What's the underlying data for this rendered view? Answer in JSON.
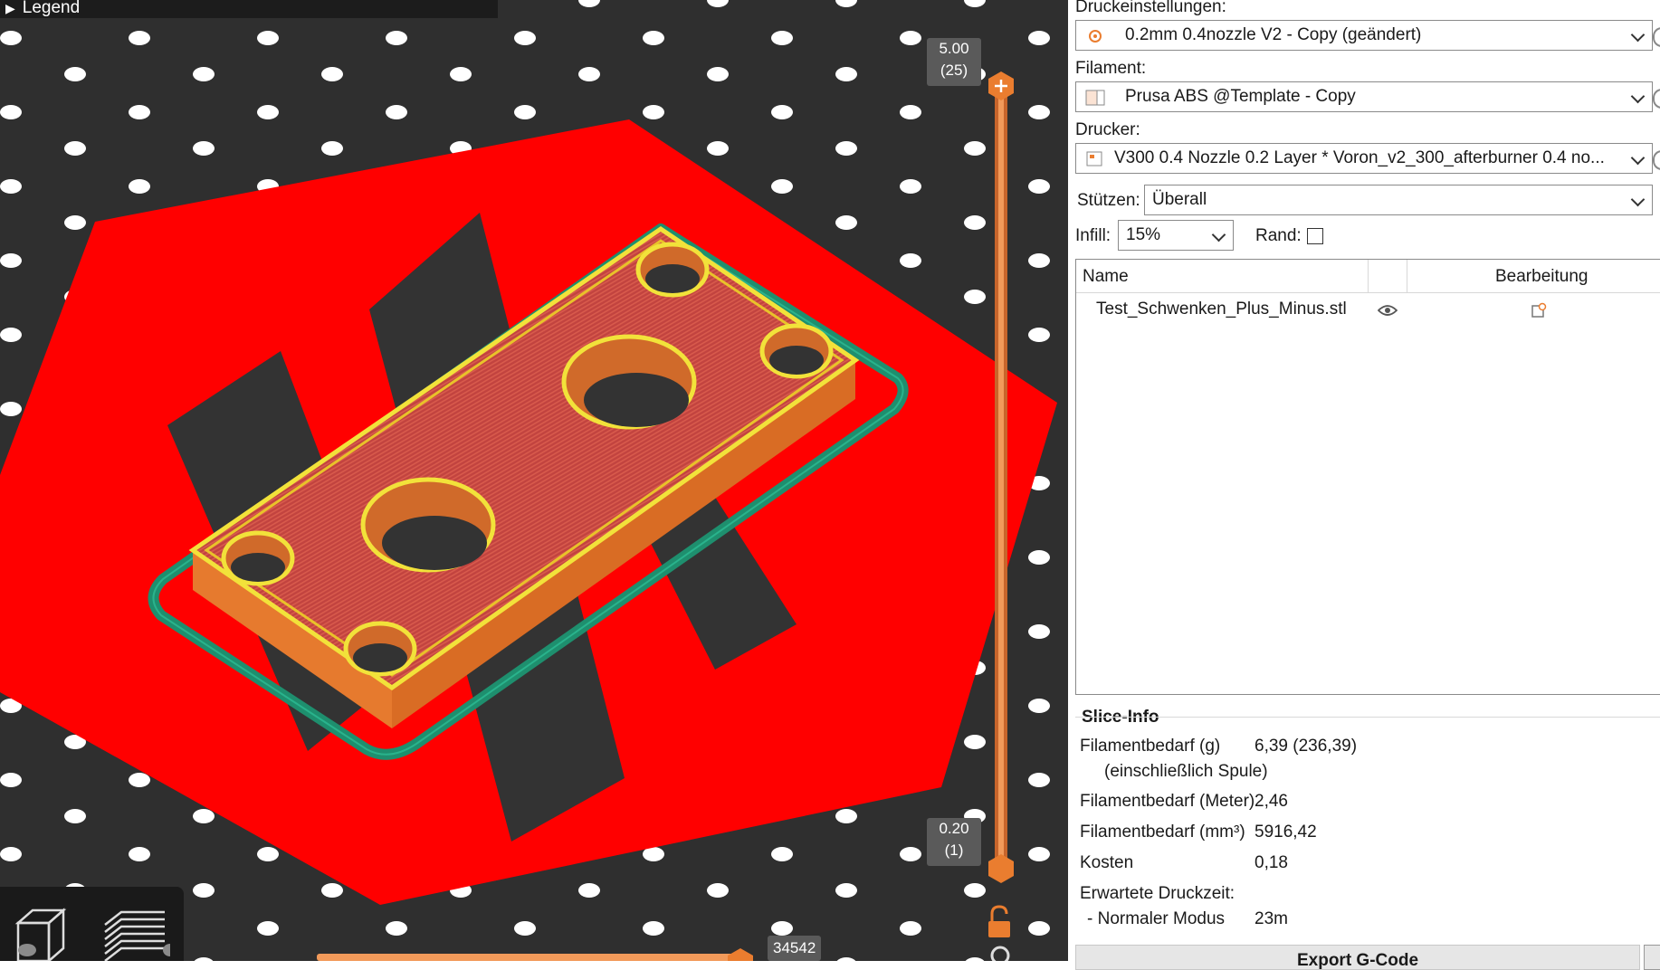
{
  "viewport": {
    "legend_label": "Legend",
    "layer_top": {
      "height": "5.00",
      "index": "(25)"
    },
    "layer_bottom": {
      "height": "0.20",
      "index": "(1)"
    },
    "move_count": "34542"
  },
  "sidebar": {
    "print_settings_label": "Druckeinstellungen:",
    "print_settings_value": "0.2mm 0.4nozzle V2 - Copy (geändert)",
    "filament_label": "Filament:",
    "filament_value": "Prusa ABS @Template - Copy",
    "printer_label": "Drucker:",
    "printer_value": "V300 0.4 Nozzle 0.2 Layer * Voron_v2_300_afterburner 0.4 no...",
    "supports_label": "Stützen:",
    "supports_value": "Überall",
    "infill_label": "Infill:",
    "infill_value": "15%",
    "brim_label": "Rand:",
    "object_list": {
      "col_name": "Name",
      "col_edit": "Bearbeitung",
      "objects": [
        {
          "name": "Test_Schwenken_Plus_Minus.stl"
        }
      ]
    },
    "slice_info": {
      "title": "Slice-Info",
      "rows": [
        {
          "label": "Filamentbedarf (g)",
          "value": "6,39 (236,39)"
        },
        {
          "label": "(einschließlich Spule)",
          "value": ""
        },
        {
          "label": "Filamentbedarf (Meter)",
          "value": "2,46"
        },
        {
          "label": "Filamentbedarf (mm³)",
          "value": "5916,42"
        },
        {
          "label": "Kosten",
          "value": "0,18"
        },
        {
          "label": "Erwartete Druckzeit:",
          "value": ""
        },
        {
          "label": "- Normaler Modus",
          "value": "23m"
        }
      ]
    },
    "export_label": "Export G-Code"
  },
  "colors": {
    "accent": "#ea7d2f",
    "bed_red": "#ff0000",
    "viewport_bg": "#2f2f2f",
    "part_orange": "#e67a2e",
    "perimeter_yellow": "#f2e23a",
    "skirt_green": "#1e8f6e"
  },
  "icons": {
    "view_3d": "cube-icon",
    "view_layers": "layers-icon",
    "visibility": "eye-icon",
    "edit": "settings-edit-icon",
    "lock": "unlock-icon"
  }
}
